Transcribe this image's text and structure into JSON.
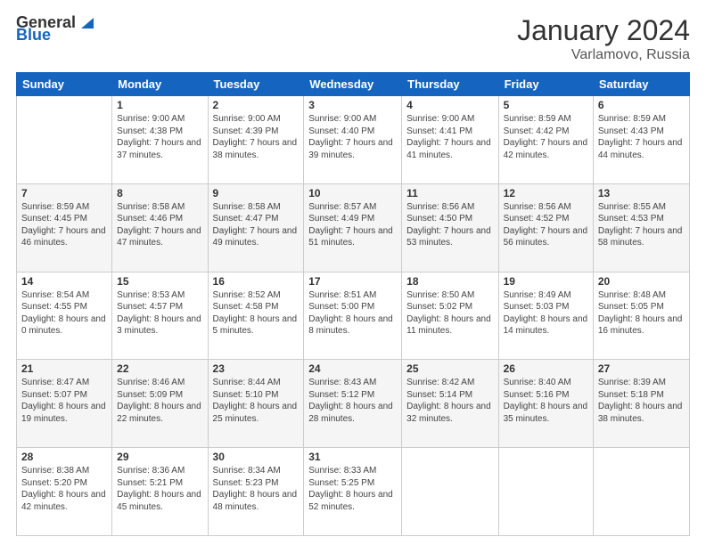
{
  "header": {
    "logo_general": "General",
    "logo_blue": "Blue",
    "month": "January 2024",
    "location": "Varlamovo, Russia"
  },
  "weekdays": [
    "Sunday",
    "Monday",
    "Tuesday",
    "Wednesday",
    "Thursday",
    "Friday",
    "Saturday"
  ],
  "weeks": [
    [
      {
        "date": "",
        "sunrise": "",
        "sunset": "",
        "daylight": ""
      },
      {
        "date": "1",
        "sunrise": "Sunrise: 9:00 AM",
        "sunset": "Sunset: 4:38 PM",
        "daylight": "Daylight: 7 hours and 37 minutes."
      },
      {
        "date": "2",
        "sunrise": "Sunrise: 9:00 AM",
        "sunset": "Sunset: 4:39 PM",
        "daylight": "Daylight: 7 hours and 38 minutes."
      },
      {
        "date": "3",
        "sunrise": "Sunrise: 9:00 AM",
        "sunset": "Sunset: 4:40 PM",
        "daylight": "Daylight: 7 hours and 39 minutes."
      },
      {
        "date": "4",
        "sunrise": "Sunrise: 9:00 AM",
        "sunset": "Sunset: 4:41 PM",
        "daylight": "Daylight: 7 hours and 41 minutes."
      },
      {
        "date": "5",
        "sunrise": "Sunrise: 8:59 AM",
        "sunset": "Sunset: 4:42 PM",
        "daylight": "Daylight: 7 hours and 42 minutes."
      },
      {
        "date": "6",
        "sunrise": "Sunrise: 8:59 AM",
        "sunset": "Sunset: 4:43 PM",
        "daylight": "Daylight: 7 hours and 44 minutes."
      }
    ],
    [
      {
        "date": "7",
        "sunrise": "Sunrise: 8:59 AM",
        "sunset": "Sunset: 4:45 PM",
        "daylight": "Daylight: 7 hours and 46 minutes."
      },
      {
        "date": "8",
        "sunrise": "Sunrise: 8:58 AM",
        "sunset": "Sunset: 4:46 PM",
        "daylight": "Daylight: 7 hours and 47 minutes."
      },
      {
        "date": "9",
        "sunrise": "Sunrise: 8:58 AM",
        "sunset": "Sunset: 4:47 PM",
        "daylight": "Daylight: 7 hours and 49 minutes."
      },
      {
        "date": "10",
        "sunrise": "Sunrise: 8:57 AM",
        "sunset": "Sunset: 4:49 PM",
        "daylight": "Daylight: 7 hours and 51 minutes."
      },
      {
        "date": "11",
        "sunrise": "Sunrise: 8:56 AM",
        "sunset": "Sunset: 4:50 PM",
        "daylight": "Daylight: 7 hours and 53 minutes."
      },
      {
        "date": "12",
        "sunrise": "Sunrise: 8:56 AM",
        "sunset": "Sunset: 4:52 PM",
        "daylight": "Daylight: 7 hours and 56 minutes."
      },
      {
        "date": "13",
        "sunrise": "Sunrise: 8:55 AM",
        "sunset": "Sunset: 4:53 PM",
        "daylight": "Daylight: 7 hours and 58 minutes."
      }
    ],
    [
      {
        "date": "14",
        "sunrise": "Sunrise: 8:54 AM",
        "sunset": "Sunset: 4:55 PM",
        "daylight": "Daylight: 8 hours and 0 minutes."
      },
      {
        "date": "15",
        "sunrise": "Sunrise: 8:53 AM",
        "sunset": "Sunset: 4:57 PM",
        "daylight": "Daylight: 8 hours and 3 minutes."
      },
      {
        "date": "16",
        "sunrise": "Sunrise: 8:52 AM",
        "sunset": "Sunset: 4:58 PM",
        "daylight": "Daylight: 8 hours and 5 minutes."
      },
      {
        "date": "17",
        "sunrise": "Sunrise: 8:51 AM",
        "sunset": "Sunset: 5:00 PM",
        "daylight": "Daylight: 8 hours and 8 minutes."
      },
      {
        "date": "18",
        "sunrise": "Sunrise: 8:50 AM",
        "sunset": "Sunset: 5:02 PM",
        "daylight": "Daylight: 8 hours and 11 minutes."
      },
      {
        "date": "19",
        "sunrise": "Sunrise: 8:49 AM",
        "sunset": "Sunset: 5:03 PM",
        "daylight": "Daylight: 8 hours and 14 minutes."
      },
      {
        "date": "20",
        "sunrise": "Sunrise: 8:48 AM",
        "sunset": "Sunset: 5:05 PM",
        "daylight": "Daylight: 8 hours and 16 minutes."
      }
    ],
    [
      {
        "date": "21",
        "sunrise": "Sunrise: 8:47 AM",
        "sunset": "Sunset: 5:07 PM",
        "daylight": "Daylight: 8 hours and 19 minutes."
      },
      {
        "date": "22",
        "sunrise": "Sunrise: 8:46 AM",
        "sunset": "Sunset: 5:09 PM",
        "daylight": "Daylight: 8 hours and 22 minutes."
      },
      {
        "date": "23",
        "sunrise": "Sunrise: 8:44 AM",
        "sunset": "Sunset: 5:10 PM",
        "daylight": "Daylight: 8 hours and 25 minutes."
      },
      {
        "date": "24",
        "sunrise": "Sunrise: 8:43 AM",
        "sunset": "Sunset: 5:12 PM",
        "daylight": "Daylight: 8 hours and 28 minutes."
      },
      {
        "date": "25",
        "sunrise": "Sunrise: 8:42 AM",
        "sunset": "Sunset: 5:14 PM",
        "daylight": "Daylight: 8 hours and 32 minutes."
      },
      {
        "date": "26",
        "sunrise": "Sunrise: 8:40 AM",
        "sunset": "Sunset: 5:16 PM",
        "daylight": "Daylight: 8 hours and 35 minutes."
      },
      {
        "date": "27",
        "sunrise": "Sunrise: 8:39 AM",
        "sunset": "Sunset: 5:18 PM",
        "daylight": "Daylight: 8 hours and 38 minutes."
      }
    ],
    [
      {
        "date": "28",
        "sunrise": "Sunrise: 8:38 AM",
        "sunset": "Sunset: 5:20 PM",
        "daylight": "Daylight: 8 hours and 42 minutes."
      },
      {
        "date": "29",
        "sunrise": "Sunrise: 8:36 AM",
        "sunset": "Sunset: 5:21 PM",
        "daylight": "Daylight: 8 hours and 45 minutes."
      },
      {
        "date": "30",
        "sunrise": "Sunrise: 8:34 AM",
        "sunset": "Sunset: 5:23 PM",
        "daylight": "Daylight: 8 hours and 48 minutes."
      },
      {
        "date": "31",
        "sunrise": "Sunrise: 8:33 AM",
        "sunset": "Sunset: 5:25 PM",
        "daylight": "Daylight: 8 hours and 52 minutes."
      },
      {
        "date": "",
        "sunrise": "",
        "sunset": "",
        "daylight": ""
      },
      {
        "date": "",
        "sunrise": "",
        "sunset": "",
        "daylight": ""
      },
      {
        "date": "",
        "sunrise": "",
        "sunset": "",
        "daylight": ""
      }
    ]
  ]
}
